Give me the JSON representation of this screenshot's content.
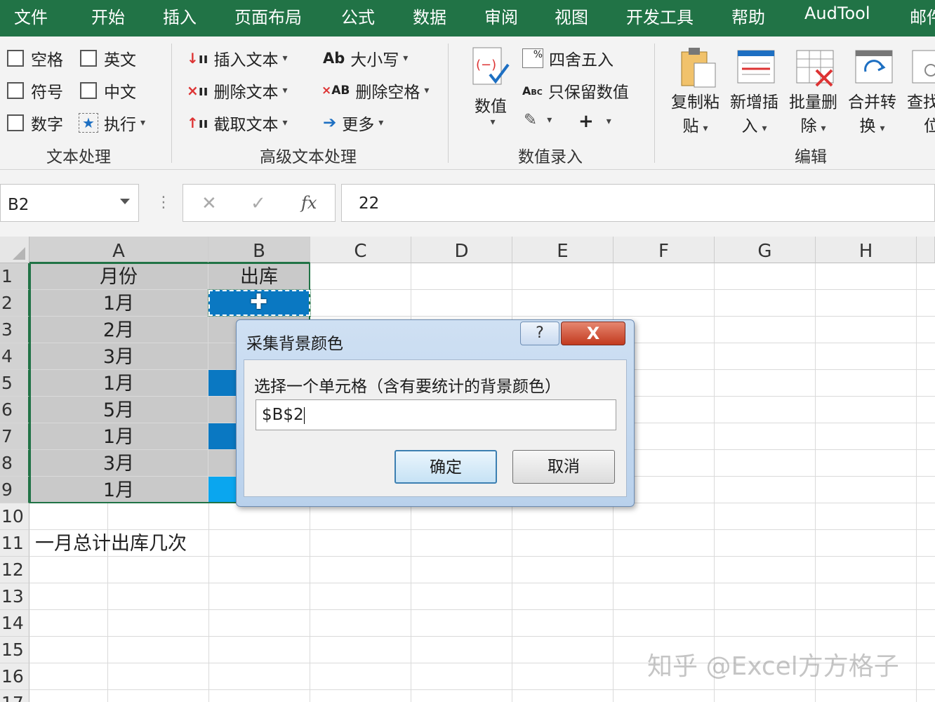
{
  "ribbon_tabs": [
    "文件",
    "开始",
    "插入",
    "页面布局",
    "公式",
    "数据",
    "审阅",
    "视图",
    "开发工具",
    "帮助",
    "AudTool",
    "邮件"
  ],
  "groups": {
    "text_processing": {
      "label": "文本处理",
      "items": [
        "空格",
        "英文",
        "符号",
        "中文",
        "数字",
        "执行"
      ]
    },
    "advanced_text": {
      "label": "高级文本处理",
      "items": [
        "插入文本",
        "大小写",
        "删除文本",
        "删除空格",
        "截取文本",
        "更多"
      ],
      "ab_icon": "Ab",
      "ab_small_icon": "AB"
    },
    "number_entry": {
      "label": "数值录入",
      "items": [
        "数值",
        "四舍五入",
        "只保留数值",
        "+"
      ],
      "abc_icon": "Abc"
    },
    "edit": {
      "label": "编辑",
      "items": [
        {
          "line1": "复制粘",
          "line2": "贴"
        },
        {
          "line1": "新增插",
          "line2": "入"
        },
        {
          "line1": "批量删",
          "line2": "除"
        },
        {
          "line1": "合并转",
          "line2": "换"
        },
        {
          "line1": "查找",
          "line2": "位"
        }
      ]
    }
  },
  "formula_bar": {
    "name_box": "B2",
    "value": "22",
    "fx": "fx"
  },
  "columns": [
    "A",
    "B",
    "C",
    "D",
    "E",
    "F",
    "G",
    "H"
  ],
  "rows": [
    "1",
    "2",
    "3",
    "4",
    "5",
    "6",
    "7",
    "8",
    "9",
    "10",
    "11",
    "12",
    "13",
    "14",
    "15",
    "16",
    "17"
  ],
  "cells": {
    "A": [
      "月份",
      "1月",
      "2月",
      "3月",
      "1月",
      "5月",
      "1月",
      "3月",
      "1月"
    ],
    "B1": "出库",
    "A11": "一月总计出库几次"
  },
  "cell_colors": {
    "grey": "#c9c9c9",
    "blue": "#0a78c2",
    "light_blue": "#0aa6ef",
    "accent_green": "#217346"
  },
  "dialog": {
    "title": "采集背景颜色",
    "help": "?",
    "close": "X",
    "prompt": "选择一个单元格（含有要统计的背景颜色）",
    "input_value": "$B$2",
    "ok": "确定",
    "cancel": "取消"
  },
  "watermark": "知乎 @Excel方方格子"
}
